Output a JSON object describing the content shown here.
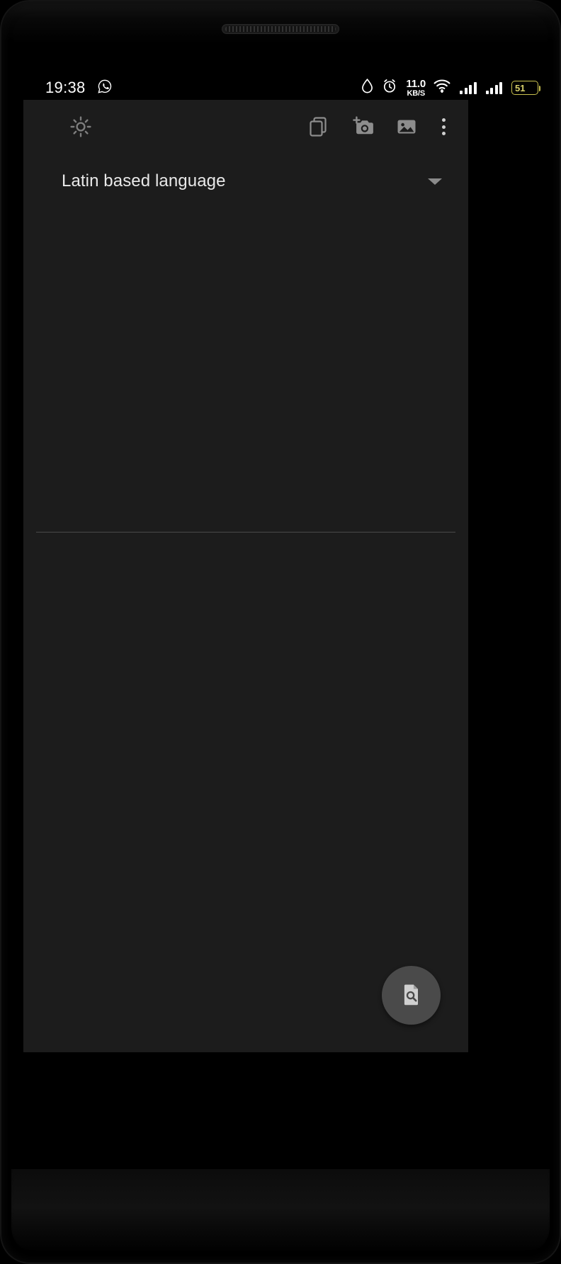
{
  "status_bar": {
    "time": "19:38",
    "left_icons": [
      {
        "name": "whatsapp-icon",
        "glyph": "whatsapp"
      }
    ],
    "right_icons": [
      {
        "name": "water-drop-icon",
        "glyph": "drop"
      },
      {
        "name": "alarm-clock-icon",
        "glyph": "alarm"
      }
    ],
    "network_speed": {
      "value": "11.0",
      "unit": "KB/S"
    },
    "wifi": "wifi-icon",
    "signal_sim1": "signal-bars-icon",
    "signal_sim2": "signal-bars-icon",
    "battery": {
      "level": "51",
      "color": "#c9c14f"
    }
  },
  "toolbar": {
    "brightness_label": "brightness-icon",
    "copy_label": "copy-icon",
    "camera_label": "add-photo-camera-icon",
    "gallery_label": "image-gallery-icon",
    "overflow_label": "more-options-icon"
  },
  "language_selector": {
    "value": "Latin based language",
    "caret": "dropdown-caret-icon"
  },
  "editor": {
    "text": "",
    "placeholder": ""
  },
  "fab": {
    "label": "scan-document-icon"
  },
  "theme": {
    "background": "#000000",
    "app_surface": "#1c1c1c",
    "icon_tint": "#9a9a9a",
    "text_primary": "#e9e9e9",
    "divider": "#4a4a4a",
    "fab_background": "#4a4a4a",
    "battery_accent": "#c9c14f"
  }
}
